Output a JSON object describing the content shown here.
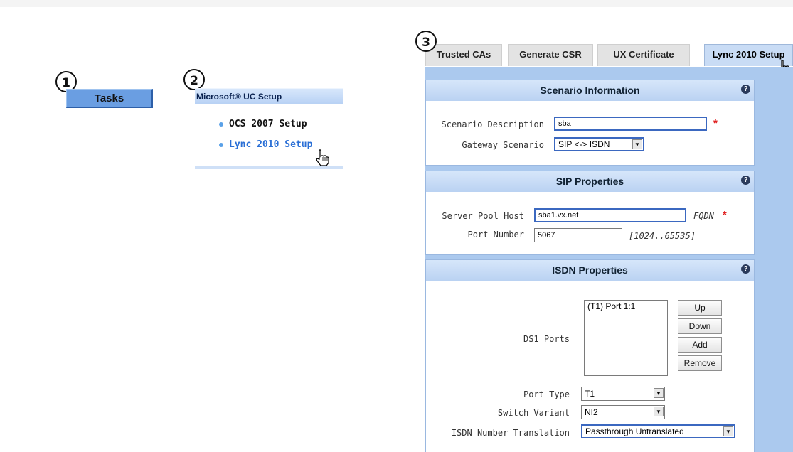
{
  "steps": {
    "step1": "1",
    "step2": "2",
    "step3": "3"
  },
  "tasks_button": {
    "label": "Tasks"
  },
  "uc_setup": {
    "title": "Microsoft® UC Setup",
    "links": [
      "OCS 2007 Setup",
      "Lync 2010 Setup"
    ]
  },
  "tabs": [
    "Trusted CAs",
    "Generate CSR",
    "UX Certificate",
    "Lync 2010 Setup"
  ],
  "help_glyph": "?",
  "scenario": {
    "title": "Scenario Information",
    "description_label": "Scenario Description",
    "description_value": "sba",
    "gateway_label": "Gateway Scenario",
    "gateway_value": "SIP <-> ISDN"
  },
  "sip": {
    "title": "SIP Properties",
    "server_label": "Server Pool Host",
    "server_value": "sba1.vx.net",
    "server_hint": "FQDN",
    "port_label": "Port Number",
    "port_value": "5067",
    "port_hint": "[1024..65535]"
  },
  "isdn": {
    "title": "ISDN Properties",
    "ds1_label": "DS1 Ports",
    "ds1_items": [
      "(T1) Port 1:1"
    ],
    "buttons": {
      "up": "Up",
      "down": "Down",
      "add": "Add",
      "remove": "Remove"
    },
    "port_type_label": "Port Type",
    "port_type_value": "T1",
    "switch_label": "Switch Variant",
    "switch_value": "NI2",
    "translation_label": "ISDN Number Translation",
    "translation_value": "Passthrough Untranslated"
  },
  "required_marker": "*",
  "icons": [
    "hand-pointer-icon",
    "help-icon",
    "bullet-icon",
    "dropdown-arrow-icon"
  ],
  "colors": {
    "accent": "#6a9ee2",
    "panel_bg": "#abc9ee",
    "required": "#e02020",
    "link": "#2a6fd6"
  }
}
